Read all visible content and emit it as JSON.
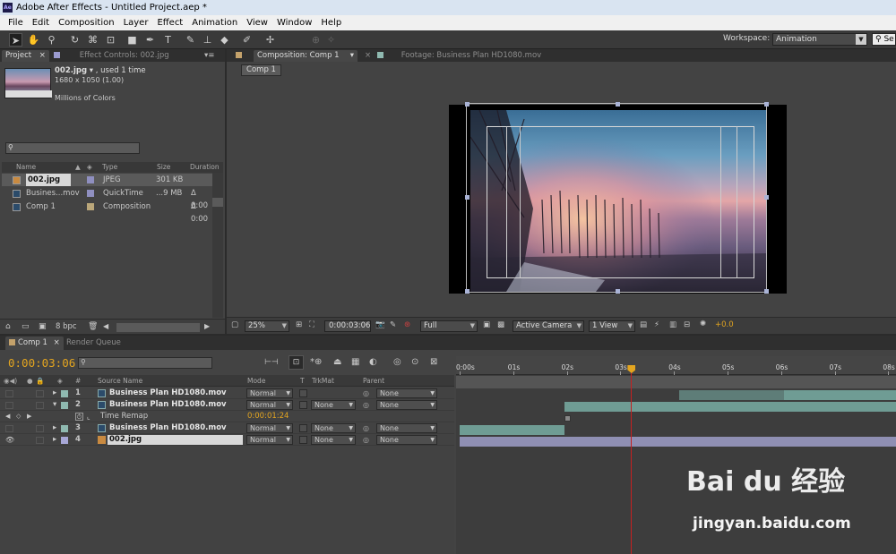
{
  "title": "Adobe After Effects - Untitled Project.aep *",
  "menu": [
    "File",
    "Edit",
    "Composition",
    "Layer",
    "Effect",
    "Animation",
    "View",
    "Window",
    "Help"
  ],
  "toolbar": {
    "tools": [
      "selection-tool",
      "hand-tool",
      "zoom-tool",
      "rotation-tool",
      "camera-tool",
      "pan-behind-tool",
      "rectangle-tool",
      "pen-tool",
      "type-tool",
      "brush-tool",
      "clone-stamp-tool",
      "eraser-tool",
      "roto-brush-tool",
      "puppet-pin-tool"
    ],
    "workspace_label": "Workspace:",
    "workspace_value": "Animation",
    "search_help": "Se"
  },
  "project_panel": {
    "tab_project": "Project",
    "tab_effect_controls": "Effect Controls: 002.jpg",
    "selected_name": "002.jpg",
    "used": ", used 1 time",
    "dimensions": "1680 x 1050 (1.00)",
    "color_info": "Millions of Colors",
    "columns": {
      "name": "Name",
      "type": "Type",
      "size": "Size",
      "duration": "Duration"
    },
    "items": [
      {
        "name": "002.jpg",
        "type": "JPEG",
        "size": "301 KB",
        "duration": "",
        "label_color": "#8f8fc0",
        "selected": true
      },
      {
        "name": "Busines...mov",
        "type": "QuickTime",
        "size": "...9 MB",
        "duration": "Δ 0:00",
        "label_color": "#8f8fc0",
        "selected": false
      },
      {
        "name": "Comp 1",
        "type": "Composition",
        "size": "",
        "duration": "Δ 0:00",
        "label_color": "#bba77a",
        "selected": false
      }
    ],
    "bpc": "8 bpc"
  },
  "comp_panel": {
    "tab_composition": "Composition: Comp 1",
    "tab_footage": "Footage: Business Plan HD1080.mov",
    "inner_tab": "Comp 1",
    "zoom": "25%",
    "timecode": "0:00:03:06",
    "resolution": "Full",
    "camera": "Active Camera",
    "views": "1 View",
    "exposure": "+0.0"
  },
  "timeline": {
    "tab_comp": "Comp 1",
    "tab_render": "Render Queue",
    "timecode": "0:00:03:06",
    "columns": {
      "source": "Source Name",
      "mode": "Mode",
      "t": "T",
      "trkmat": "TrkMat",
      "parent": "Parent"
    },
    "layers": [
      {
        "num": "1",
        "name": "Business Plan HD1080.mov",
        "mode": "Normal",
        "trkmat": "",
        "parent": "None",
        "label_color": "#8fb9b0"
      },
      {
        "num": "2",
        "name": "Business Plan HD1080.mov",
        "mode": "Normal",
        "trkmat": "None",
        "parent": "None",
        "label_color": "#8fb9b0"
      },
      {
        "num": "3",
        "name": "Business Plan HD1080.mov",
        "mode": "Normal",
        "trkmat": "None",
        "parent": "None",
        "label_color": "#8fb9b0"
      },
      {
        "num": "4",
        "name": "002.jpg",
        "mode": "Normal",
        "trkmat": "None",
        "parent": "None",
        "label_color": "#a7a7d6"
      }
    ],
    "time_remap_label": "Time Remap",
    "time_remap_value": "0:00:01:24",
    "ruler": [
      "0:00s",
      "01s",
      "02s",
      "03s",
      "04s",
      "05s",
      "06s",
      "07s",
      "08s"
    ],
    "bars": [
      {
        "row": 1,
        "start_sec": 4.1,
        "end_sec": 8.3,
        "color": "#5e7d78"
      },
      {
        "row": 1,
        "start_sec": 6.05,
        "end_sec": 8.3,
        "color": "#6f9c94"
      },
      {
        "row": 2,
        "start_sec": 1.95,
        "end_sec": 8.3,
        "color": "#6f9c94"
      },
      {
        "row": 4,
        "start_sec": 0.0,
        "end_sec": 1.95,
        "color": "#6f9c94"
      },
      {
        "row": 5,
        "start_sec": 0.0,
        "end_sec": 8.3,
        "color": "#8f8fb3"
      }
    ],
    "current_time_sec": 3.2
  },
  "watermark": {
    "text": "Bai du 经验",
    "url": "jingyan.baidu.com"
  }
}
